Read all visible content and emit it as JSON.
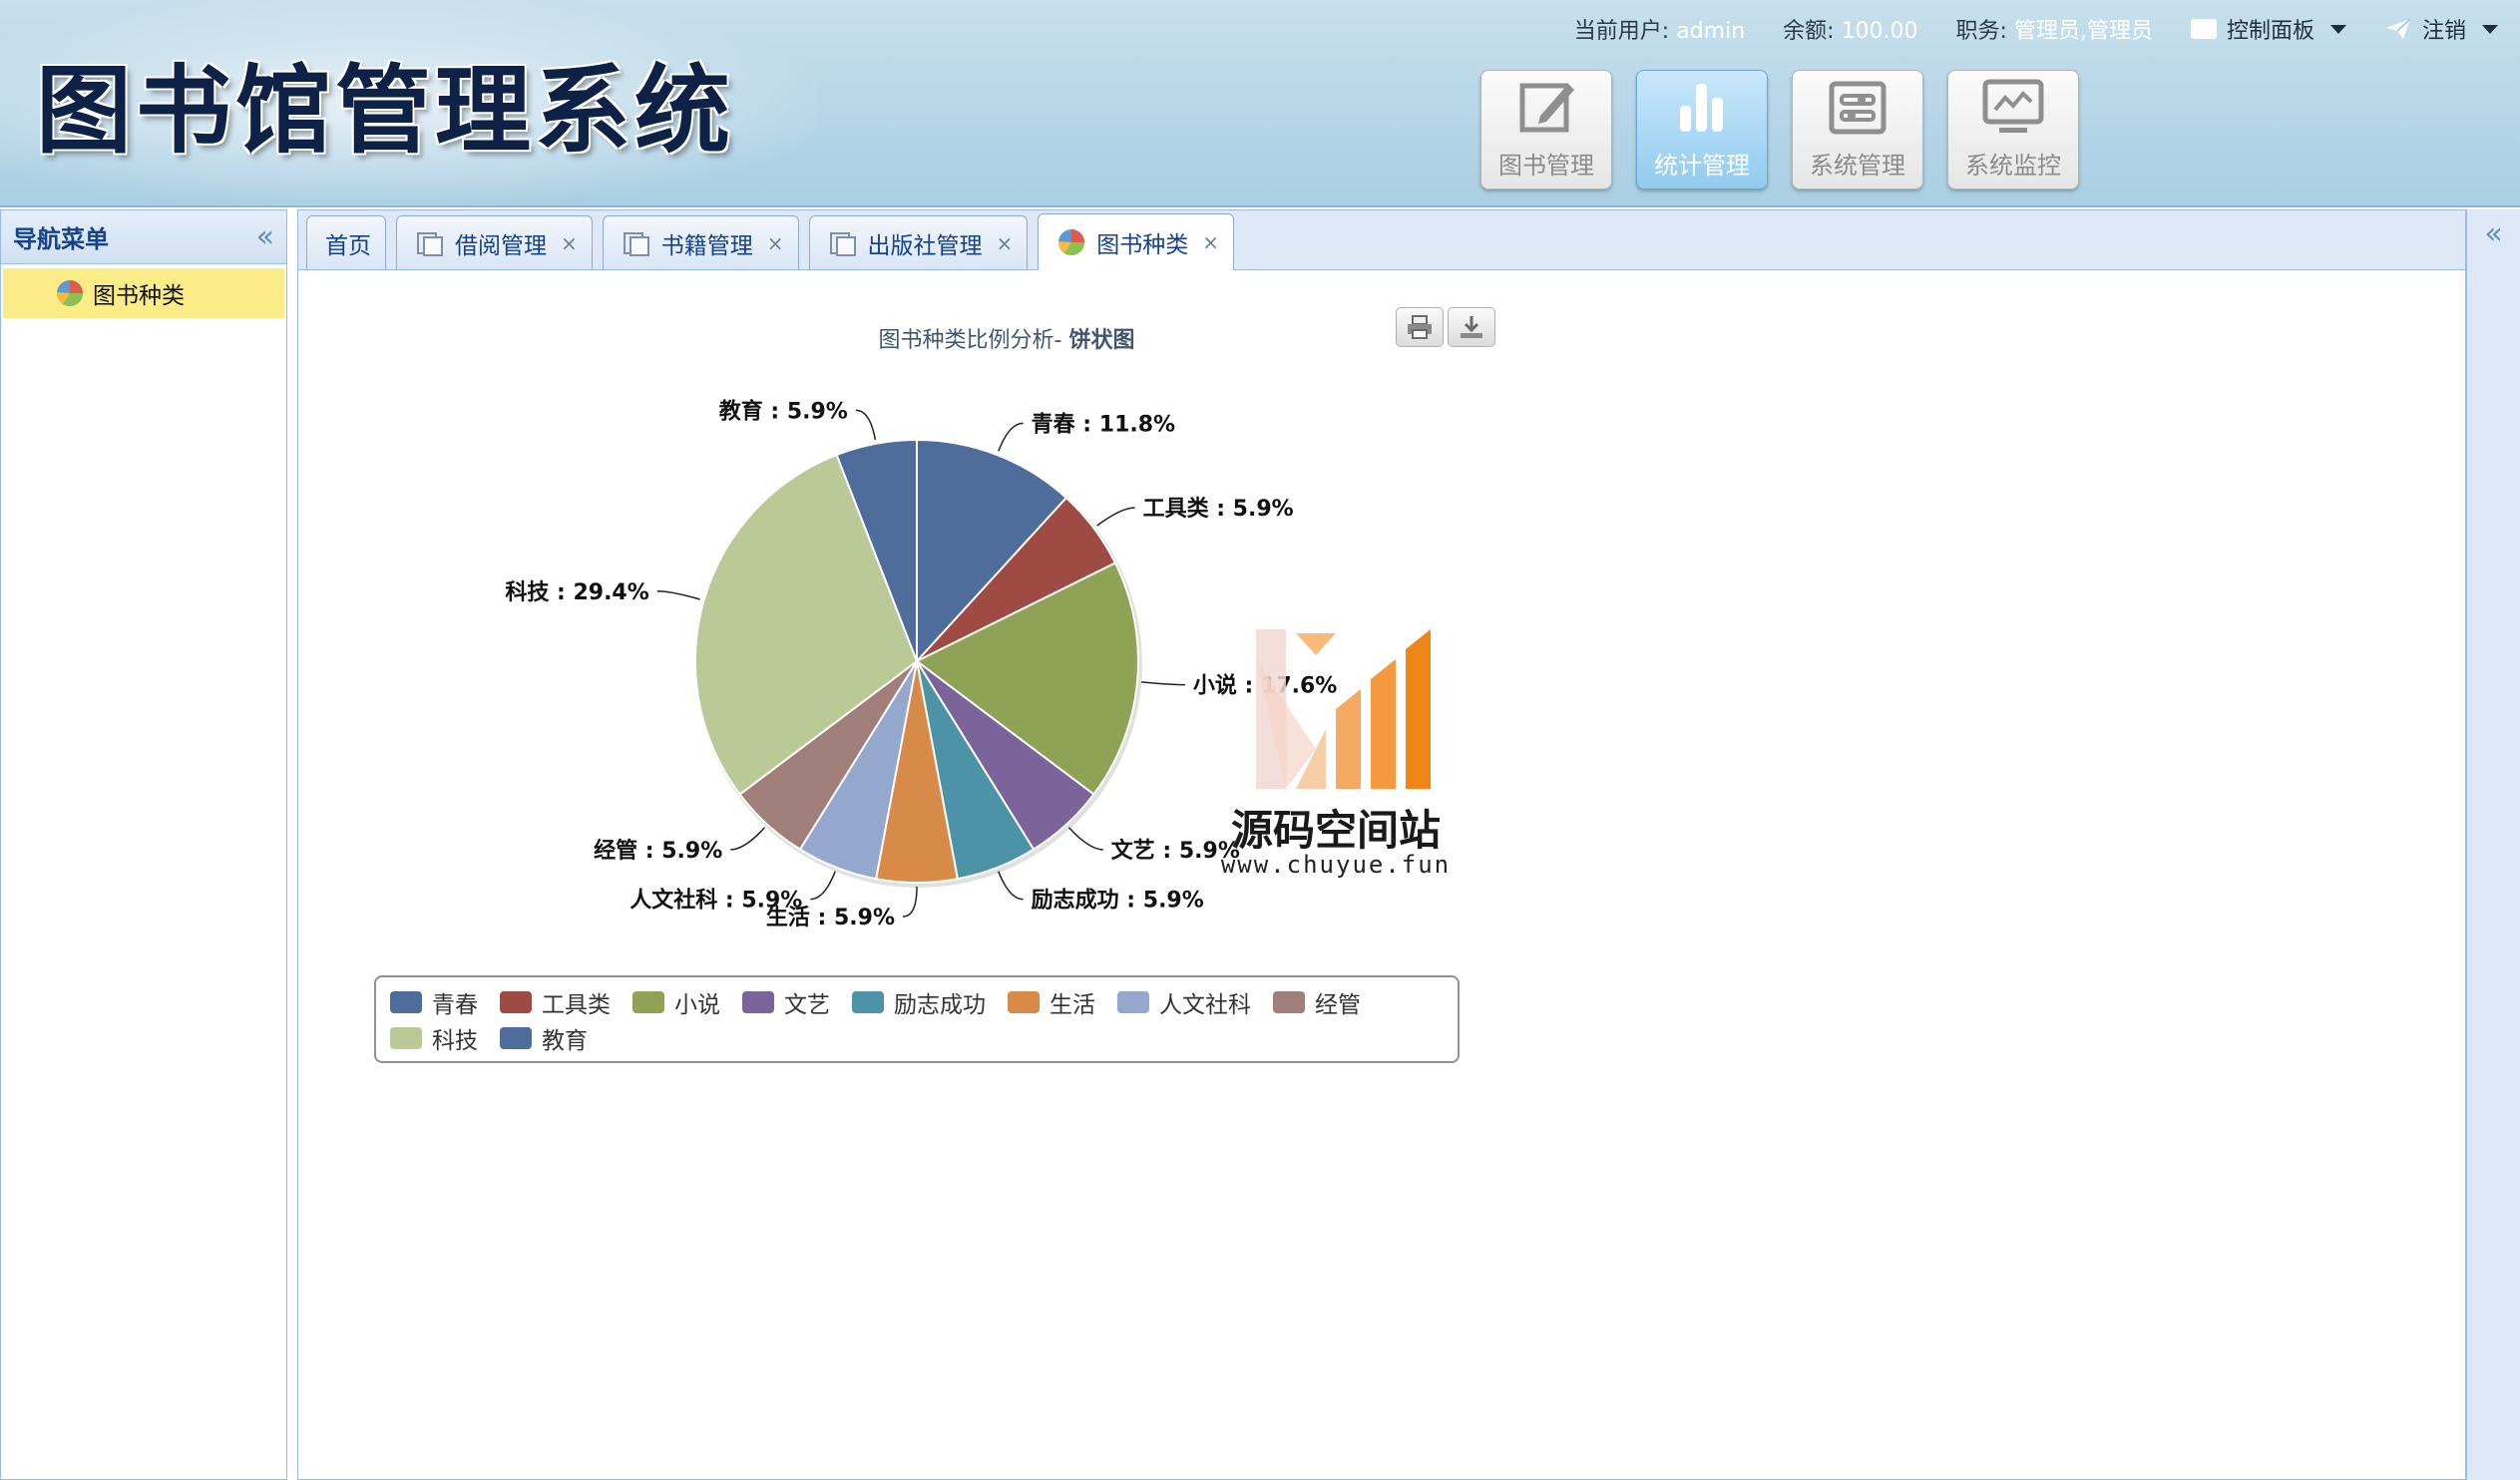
{
  "header": {
    "app_title": "图书馆管理系统",
    "user_label": "当前用户:",
    "user_value": "admin",
    "balance_label": "余额:",
    "balance_value": "100.00",
    "role_label": "职务:",
    "role_value": "管理员,管理员",
    "control_panel": "控制面板",
    "logout": "注销"
  },
  "modules": [
    {
      "label": "图书管理",
      "icon": "edit-icon",
      "active": false
    },
    {
      "label": "统计管理",
      "icon": "bar-chart-icon",
      "active": true
    },
    {
      "label": "系统管理",
      "icon": "settings-icon",
      "active": false
    },
    {
      "label": "系统监控",
      "icon": "monitor-icon",
      "active": false
    }
  ],
  "sidebar": {
    "title": "导航菜单",
    "items": [
      {
        "label": "图书种类",
        "icon": "pie-chart-icon",
        "selected": true
      }
    ]
  },
  "tabs": [
    {
      "label": "首页",
      "icon": "",
      "closable": false,
      "active": false
    },
    {
      "label": "借阅管理",
      "icon": "document-icon",
      "closable": true,
      "active": false
    },
    {
      "label": "书籍管理",
      "icon": "document-icon",
      "closable": true,
      "active": false
    },
    {
      "label": "出版社管理",
      "icon": "document-icon",
      "closable": true,
      "active": false
    },
    {
      "label": "图书种类",
      "icon": "pie-chart-icon",
      "closable": true,
      "active": true
    }
  ],
  "close_glyph": "×",
  "chart": {
    "title_prefix": "图书种类比例分析-",
    "title_bold": "饼状图"
  },
  "chart_data": {
    "type": "pie",
    "title": "图书种类比例分析- 饼状图",
    "categories": [
      "青春",
      "工具类",
      "小说",
      "文艺",
      "励志成功",
      "生活",
      "人文社科",
      "经管",
      "科技",
      "教育"
    ],
    "values": [
      11.8,
      5.9,
      17.6,
      5.9,
      5.9,
      5.9,
      5.9,
      5.9,
      29.4,
      5.9
    ],
    "data_labels": [
      "青春 : 11.8%",
      "工具类 : 5.9%",
      "小说 : 17.6%",
      "文艺 : 5.9%",
      "励志成功 : 5.9%",
      "生活 : 5.9%",
      "人文社科 : 5.9%",
      "经管 : 5.9%",
      "科技 : 29.4%",
      "教育 : 5.9%"
    ],
    "colors": [
      "#4f6d9b",
      "#a04a44",
      "#8fa256",
      "#7b6499",
      "#4d93a8",
      "#d88a49",
      "#94a7cd",
      "#a07f7a",
      "#bac996",
      "#4f6d9b"
    ],
    "legend_position": "bottom"
  },
  "watermark": {
    "title": "源码空间站",
    "url": "www.chuyue.fun"
  }
}
